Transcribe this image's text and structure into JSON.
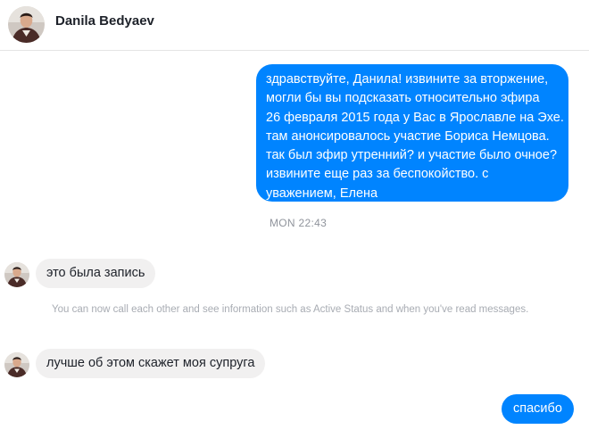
{
  "header": {
    "contact_name": "Danila Bedyaev"
  },
  "conversation": {
    "messages": [
      {
        "direction": "outgoing",
        "text": "здравствуйте, Данила! извините за вторжение,\nмогли бы вы подсказать относительно эфира\n26 февраля 2015 года у Вас в Ярославле на Эхе.\nтам анонсировалось участие Бориса Немцова.\nтак был эфир утренний? и участие было очное?\nизвините еще раз за беспокойство. с\nуважением, Елена"
      },
      {
        "direction": "incoming",
        "text": "это была запись"
      },
      {
        "direction": "incoming",
        "text": "лучше об этом скажет моя супруга"
      },
      {
        "direction": "outgoing",
        "text": "спасибо"
      }
    ],
    "timestamp": "MON 22:43",
    "notice": "You can now call each other and see information such as Active Status and when you've read messages."
  },
  "colors": {
    "outgoing_bubble": "#0084ff",
    "incoming_bubble": "#f1f0f0",
    "meta_text": "#90949c"
  }
}
